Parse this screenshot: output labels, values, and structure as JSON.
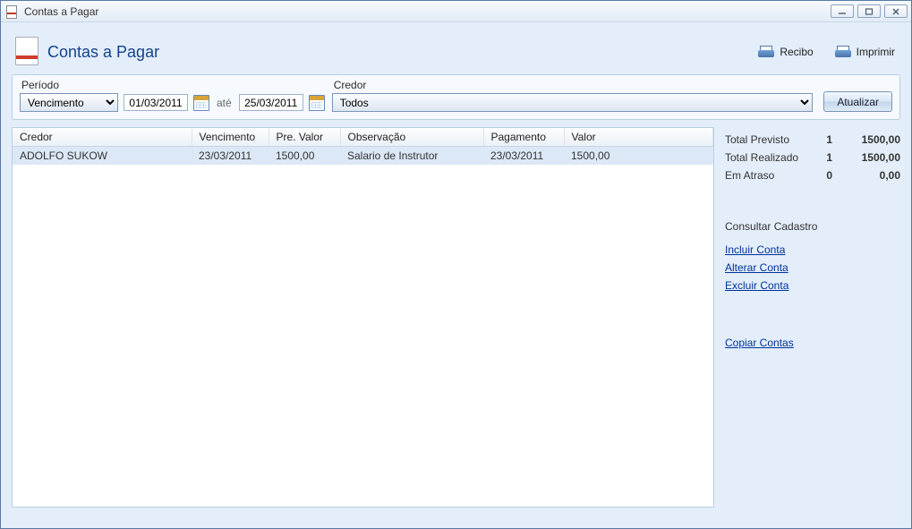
{
  "window": {
    "title": "Contas a Pagar"
  },
  "page": {
    "title": "Contas a Pagar"
  },
  "toolbar": {
    "recibo_label": "Recibo",
    "imprimir_label": "Imprimir"
  },
  "filter": {
    "periodo_label": "Período",
    "periodo_options": [
      "Vencimento"
    ],
    "periodo_selected": "Vencimento",
    "data_de": "01/03/2011",
    "ate_label": "até",
    "data_ate": "25/03/2011",
    "credor_label": "Credor",
    "credor_options": [
      "Todos"
    ],
    "credor_selected": "Todos",
    "atualizar_label": "Atualizar"
  },
  "table": {
    "headers": {
      "credor": "Credor",
      "vencimento": "Vencimento",
      "pre_valor": "Pre. Valor",
      "observacao": "Observação",
      "pagamento": "Pagamento",
      "valor": "Valor"
    },
    "rows": [
      {
        "credor": "ADOLFO SUKOW",
        "vencimento": "23/03/2011",
        "pre_valor": "1500,00",
        "observacao": "Salario de Instrutor",
        "pagamento": "23/03/2011",
        "valor": "1500,00"
      }
    ]
  },
  "totals": {
    "previsto_label": "Total Previsto",
    "previsto_count": "1",
    "previsto_value": "1500,00",
    "realizado_label": "Total Realizado",
    "realizado_count": "1",
    "realizado_value": "1500,00",
    "atraso_label": "Em Atraso",
    "atraso_count": "0",
    "atraso_value": "0,00"
  },
  "side": {
    "consultar_label": "Consultar Cadastro",
    "incluir_label": "Incluir Conta",
    "alterar_label": "Alterar Conta",
    "excluir_label": "Excluir Conta",
    "copiar_label": "Copiar Contas"
  }
}
